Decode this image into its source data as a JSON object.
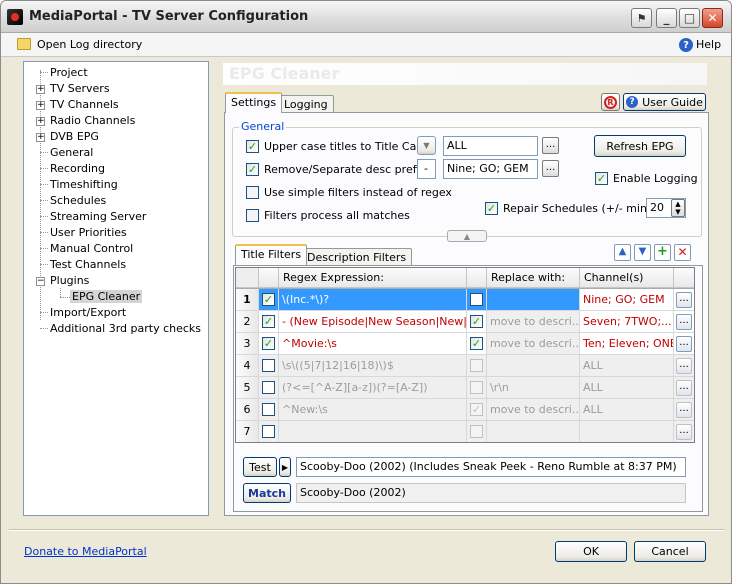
{
  "window": {
    "title": "MediaPortal - TV Server Configuration",
    "controls": {
      "minimize": "_",
      "maximize": "□",
      "close": "✕"
    }
  },
  "menubar": {
    "open_log": "Open Log directory",
    "help": "Help"
  },
  "tree": {
    "items": [
      "Project",
      "TV Servers",
      "TV Channels",
      "Radio Channels",
      "DVB EPG",
      "General",
      "Recording",
      "Timeshifting",
      "Schedules",
      "Streaming Server",
      "User Priorities",
      "Manual Control",
      "Test Channels",
      "Plugins",
      "EPG Cleaner",
      "Import/Export",
      "Additional 3rd party checks"
    ]
  },
  "pane": {
    "title": "EPG Cleaner",
    "tabs": [
      "Settings",
      "Logging"
    ],
    "user_guide": "User Guide",
    "general": {
      "label": "General",
      "upper_case_label": "Upper case titles to Title Case:",
      "upper_case_value": "ALL",
      "remove_prefix_label": "Remove/Separate desc prefix:",
      "remove_prefix_sep": "-",
      "remove_prefix_value": "Nine; GO; GEM",
      "simple_filters_label": "Use simple filters instead of regex",
      "process_all_label": "Filters process all matches",
      "refresh_epg": "Refresh EPG",
      "enable_logging": "Enable Logging",
      "repair_label": "Repair Schedules (+/- mins):",
      "repair_value": "20"
    },
    "filter_tabs": [
      "Title Filters",
      "Description Filters"
    ],
    "grid": {
      "headers": [
        "Regex Expression:",
        "Replace with:",
        "Channel(s)"
      ],
      "rows": [
        {
          "num": "1",
          "expr": "\\(Inc.*\\)?",
          "replace": "",
          "channels": "Nine; GO; GEM"
        },
        {
          "num": "2",
          "expr": " - (New Episode|New Season|New|...",
          "replace": "move to descri...",
          "channels": "Seven; 7TWO;..."
        },
        {
          "num": "3",
          "expr": "^Movie:\\s",
          "replace": "move to descri...",
          "channels": "Ten; Eleven; ONE"
        },
        {
          "num": "4",
          "expr": "\\s\\((5|7|12|16|18)\\)$",
          "replace": "",
          "channels": "ALL"
        },
        {
          "num": "5",
          "expr": "(?<=[^A-Z][a-z])(?=[A-Z])",
          "replace": "\\r\\n",
          "channels": "ALL"
        },
        {
          "num": "6",
          "expr": "^New:\\s",
          "replace": "move to descri...",
          "channels": "ALL"
        },
        {
          "num": "7",
          "expr": "",
          "replace": "",
          "channels": ""
        }
      ]
    },
    "test_button": "Test",
    "test_input": "Scooby-Doo (2002) (Includes Sneak Peek - Reno Rumble at 8:37 PM)",
    "match_label": "Match",
    "match_output": "Scooby-Doo (2002)"
  },
  "footer": {
    "donate": "Donate to MediaPortal",
    "ok": "OK",
    "cancel": "Cancel"
  },
  "colors": {
    "accent_blue": "#0046d5",
    "selection": "#3399ff",
    "red_text": "#c00000"
  },
  "icons": [
    "app-icon",
    "folder-icon",
    "help-icon",
    "up-arrow-icon",
    "down-arrow-icon",
    "add-icon",
    "delete-icon",
    "r-icon"
  ]
}
